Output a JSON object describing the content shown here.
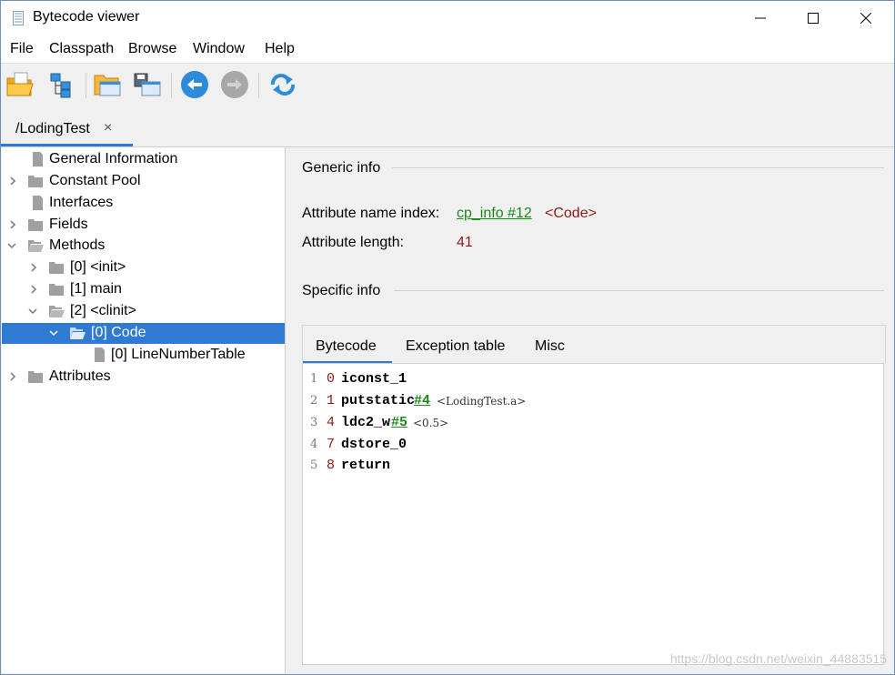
{
  "window": {
    "title": "Bytecode viewer"
  },
  "menu": [
    "File",
    "Classpath",
    "Browse",
    "Window",
    "Help"
  ],
  "toolbar": {
    "icons": [
      "open-file-icon",
      "browse-classpath-icon",
      "open-folder-icon",
      "save-icon",
      "back-icon",
      "forward-icon",
      "reload-icon"
    ]
  },
  "doc_tab": {
    "label": "/LodingTest",
    "close": "×"
  },
  "tree": {
    "nodes": [
      {
        "label": "General Information"
      },
      {
        "label": "Constant Pool"
      },
      {
        "label": "Interfaces"
      },
      {
        "label": "Fields"
      },
      {
        "label": "Methods"
      },
      {
        "label": "[0] <init>"
      },
      {
        "label": "[1] main"
      },
      {
        "label": "[2] <clinit>"
      },
      {
        "label": "[0] Code"
      },
      {
        "label": "[0] LineNumberTable"
      },
      {
        "label": "Attributes"
      }
    ]
  },
  "generic": {
    "title": "Generic info",
    "name_index_label": "Attribute name index:",
    "name_index_link": "cp_info #12",
    "name_index_value": "<Code>",
    "length_label": "Attribute length:",
    "length_value": "41"
  },
  "specific": {
    "title": "Specific info",
    "tabs": [
      "Bytecode",
      "Exception table",
      "Misc"
    ],
    "code": [
      {
        "ln": "1",
        "offset": "0",
        "op": "iconst_1",
        "arg": "",
        "comment": ""
      },
      {
        "ln": "2",
        "offset": "1",
        "op": "putstatic",
        "arg": "#4",
        "comment": "<LodingTest.a>"
      },
      {
        "ln": "3",
        "offset": "4",
        "op": "ldc2_w",
        "arg": "#5",
        "comment": "<0.5>"
      },
      {
        "ln": "4",
        "offset": "7",
        "op": "dstore_0",
        "arg": "",
        "comment": ""
      },
      {
        "ln": "5",
        "offset": "8",
        "op": "return",
        "arg": "",
        "comment": ""
      }
    ]
  },
  "watermark": "https://blog.csdn.net/weixin_44883515",
  "colors": {
    "accent": "#2f7bd3",
    "link": "#1a8a1a",
    "value": "#8b1a1a"
  }
}
